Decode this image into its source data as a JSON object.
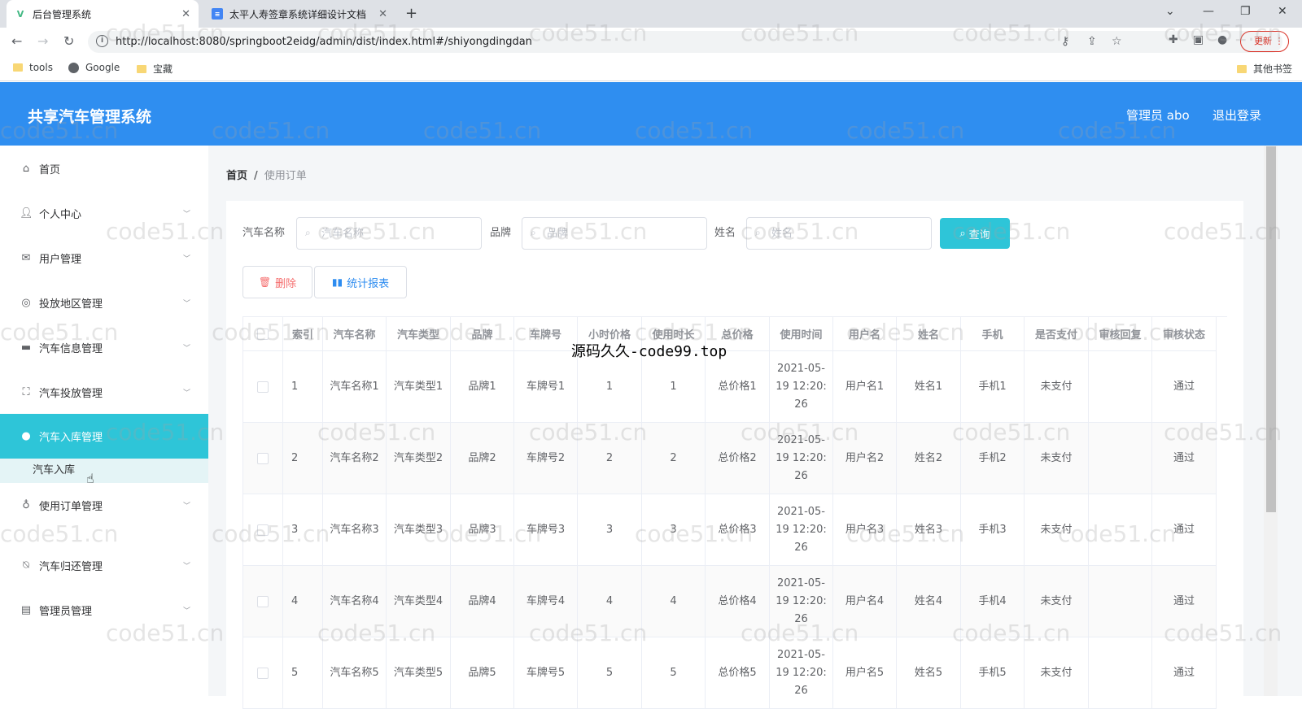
{
  "browser": {
    "tabs": [
      {
        "title": "后台管理系统",
        "icon": "vue-logo-icon",
        "active": true
      },
      {
        "title": "太平人寿签章系统详细设计文档",
        "icon": "docs-icon",
        "active": false
      }
    ],
    "url": "http://localhost:8080/springboot2eidg/admin/dist/index.html#/shiyongdingdan",
    "update_label": "更新",
    "bookmarks": [
      "tools",
      "Google",
      "宝藏"
    ],
    "other_bookmarks": "其他书签"
  },
  "header": {
    "title": "共享汽车管理系统",
    "user": "管理员 abo",
    "logout": "退出登录",
    "color": "#2f8ef0"
  },
  "sidebar": {
    "items": [
      {
        "label": "首页",
        "icon": "home-icon"
      },
      {
        "label": "个人中心",
        "icon": "user-icon"
      },
      {
        "label": "用户管理",
        "icon": "mail-icon"
      },
      {
        "label": "投放地区管理",
        "icon": "globe-icon"
      },
      {
        "label": "汽车信息管理",
        "icon": "card-icon"
      },
      {
        "label": "汽车投放管理",
        "icon": "fullscreen-icon"
      },
      {
        "label": "汽车入库管理",
        "icon": "circle-icon",
        "active": true
      },
      {
        "label": "使用订单管理",
        "icon": "microphone-icon"
      },
      {
        "label": "汽车归还管理",
        "icon": "bell-off-icon"
      },
      {
        "label": "管理员管理",
        "icon": "chat-icon"
      }
    ],
    "submenu": "汽车入库",
    "active_color": "#2ec5d8"
  },
  "breadcrumb": {
    "home": "首页",
    "separator": "/",
    "current": "使用订单"
  },
  "search": {
    "fields": [
      {
        "label": "汽车名称",
        "placeholder": "汽车名称"
      },
      {
        "label": "品牌",
        "placeholder": "品牌"
      },
      {
        "label": "姓名",
        "placeholder": "姓名"
      }
    ],
    "query_label": "查询"
  },
  "actions": {
    "delete_label": "删除",
    "stats_label": "统计报表"
  },
  "table": {
    "columns": [
      "",
      "索引",
      "汽车名称",
      "汽车类型",
      "品牌",
      "车牌号",
      "小时价格",
      "使用时长",
      "总价格",
      "使用时间",
      "用户名",
      "姓名",
      "手机",
      "是否支付",
      "审核回复",
      "审核状态"
    ],
    "rows": [
      [
        "",
        "1",
        "汽车名称1",
        "汽车类型1",
        "品牌1",
        "车牌号1",
        "1",
        "1",
        "总价格1",
        "2021-05-19 12:20:26",
        "用户名1",
        "姓名1",
        "手机1",
        "未支付",
        "",
        "通过"
      ],
      [
        "",
        "2",
        "汽车名称2",
        "汽车类型2",
        "品牌2",
        "车牌号2",
        "2",
        "2",
        "总价格2",
        "2021-05-19 12:20:26",
        "用户名2",
        "姓名2",
        "手机2",
        "未支付",
        "",
        "通过"
      ],
      [
        "",
        "3",
        "汽车名称3",
        "汽车类型3",
        "品牌3",
        "车牌号3",
        "3",
        "3",
        "总价格3",
        "2021-05-19 12:20:26",
        "用户名3",
        "姓名3",
        "手机3",
        "未支付",
        "",
        "通过"
      ],
      [
        "",
        "4",
        "汽车名称4",
        "汽车类型4",
        "品牌4",
        "车牌号4",
        "4",
        "4",
        "总价格4",
        "2021-05-19 12:20:26",
        "用户名4",
        "姓名4",
        "手机4",
        "未支付",
        "",
        "通过"
      ],
      [
        "",
        "5",
        "汽车名称5",
        "汽车类型5",
        "品牌5",
        "车牌号5",
        "5",
        "5",
        "总价格5",
        "2021-05-19 12:20:26",
        "用户名5",
        "姓名5",
        "手机5",
        "未支付",
        "",
        "通过"
      ]
    ]
  },
  "watermark": "code51.cn",
  "overlay_text": "源码久久-code99.top"
}
